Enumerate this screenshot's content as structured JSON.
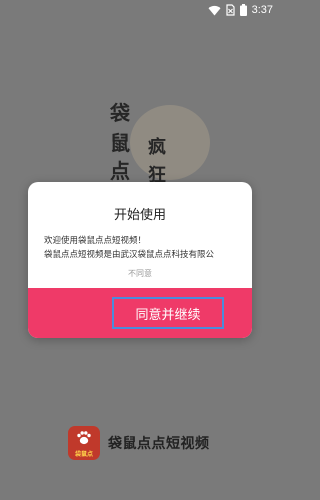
{
  "status_bar": {
    "time": "3:37"
  },
  "splash": {
    "chars": [
      "袋",
      "鼠",
      "点",
      "疯",
      "狂"
    ]
  },
  "dialog": {
    "title": "开始使用",
    "body_lines": [
      "欢迎使用袋鼠点点短视频！",
      "袋鼠点点短视频是由武汉袋鼠点点科技有限公"
    ],
    "decline_label": "不同意",
    "agree_label": "同意并继续"
  },
  "brand": {
    "icon_text": "袋鼠点",
    "name": "袋鼠点点短视频"
  },
  "colors": {
    "overlay": "#7a7a7a",
    "accent": "#ef3a68",
    "focus_border": "#4a8cdc"
  }
}
